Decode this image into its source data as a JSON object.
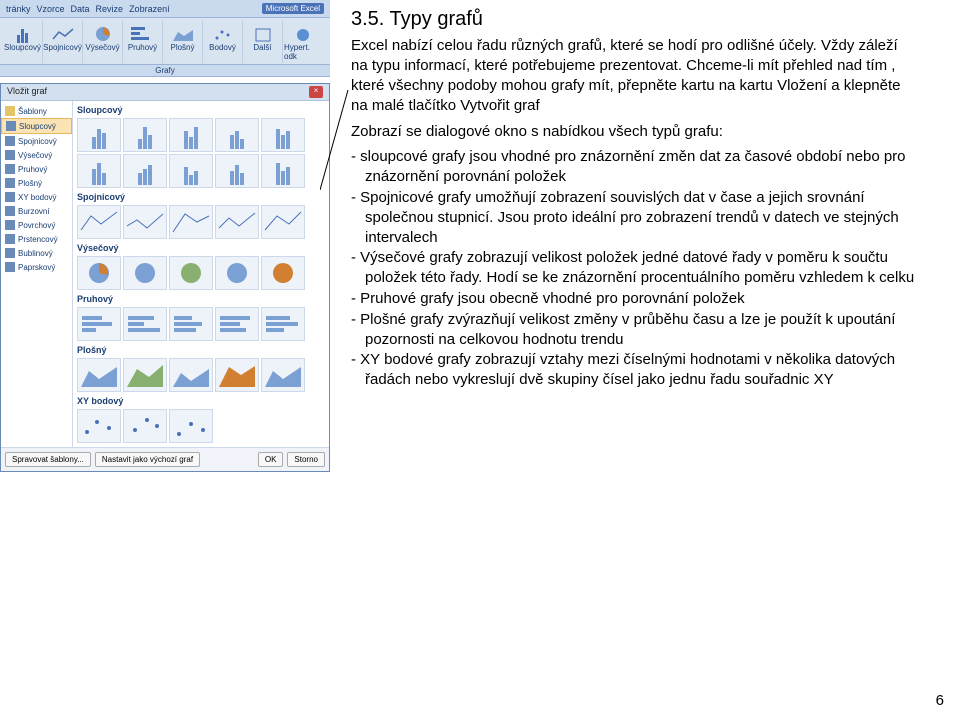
{
  "ribbon": {
    "tabs": [
      "tránky",
      "Vzorce",
      "Data",
      "Revize",
      "Zobrazení"
    ],
    "title_scrap": "Microsoft Excel",
    "group_label": "Grafy",
    "chart_buttons": [
      "Sloupcový",
      "Spojnicový",
      "Výsečový",
      "Pruhový",
      "Plošný",
      "Bodový",
      "Další",
      "Hypert. odk"
    ]
  },
  "dialog": {
    "title": "Vložit graf",
    "sidebar_header": "Šablony",
    "sidebar": [
      {
        "label": "Sloupcový",
        "selected": true
      },
      {
        "label": "Spojnicový",
        "selected": false
      },
      {
        "label": "Výsečový",
        "selected": false
      },
      {
        "label": "Pruhový",
        "selected": false
      },
      {
        "label": "Plošný",
        "selected": false
      },
      {
        "label": "XY bodový",
        "selected": false
      },
      {
        "label": "Burzovní",
        "selected": false
      },
      {
        "label": "Povrchový",
        "selected": false
      },
      {
        "label": "Prstencový",
        "selected": false
      },
      {
        "label": "Bublinový",
        "selected": false
      },
      {
        "label": "Paprskový",
        "selected": false
      }
    ],
    "sections": [
      "Sloupcový",
      "Spojnicový",
      "Výsečový",
      "Pruhový",
      "Plošný",
      "XY bodový"
    ],
    "footer": {
      "manage": "Spravovat šablony...",
      "set_default": "Nastavit jako výchozí graf",
      "ok": "OK",
      "cancel": "Storno"
    }
  },
  "text": {
    "heading": "3.5. Typy grafů",
    "intro": "Excel nabízí celou řadu různých grafů, které se hodí pro odlišné účely. Vždy záleží na typu informací, které potřebujeme prezentovat. Chceme-li mít přehled nad tím , které všechny podoby mohou grafy mít, přepněte kartu na kartu Vložení a klepněte na malé tlačítko Vytvořit graf",
    "dialog_intro": "Zobrazí se dialogové okno s nabídkou všech typů grafu:",
    "items": [
      "- sloupcové grafy jsou vhodné pro znázornění změn dat za časové období nebo pro znázornění porovnání položek",
      "- Spojnicové grafy  umožňují zobrazení souvislých dat v čase a jejich srovnání společnou stupnicí. Jsou proto ideální pro zobrazení trendů v datech ve stejných intervalech",
      "- Výsečové grafy zobrazují velikost položek jedné datové řady v poměru k součtu položek této řady. Hodí se ke znázornění procentuálního poměru vzhledem k celku",
      "- Pruhové grafy jsou obecně vhodné pro porovnání položek",
      "- Plošné grafy zvýrazňují velikost změny v průběhu času a lze je použít k upoutání pozornosti na celkovou hodnotu trendu",
      "- XY bodové grafy zobrazují vztahy mezi číselnými hodnotami v několika datových řadách nebo vykreslují dvě skupiny čísel jako jednu řadu souřadnic XY"
    ]
  },
  "page_number": "6"
}
